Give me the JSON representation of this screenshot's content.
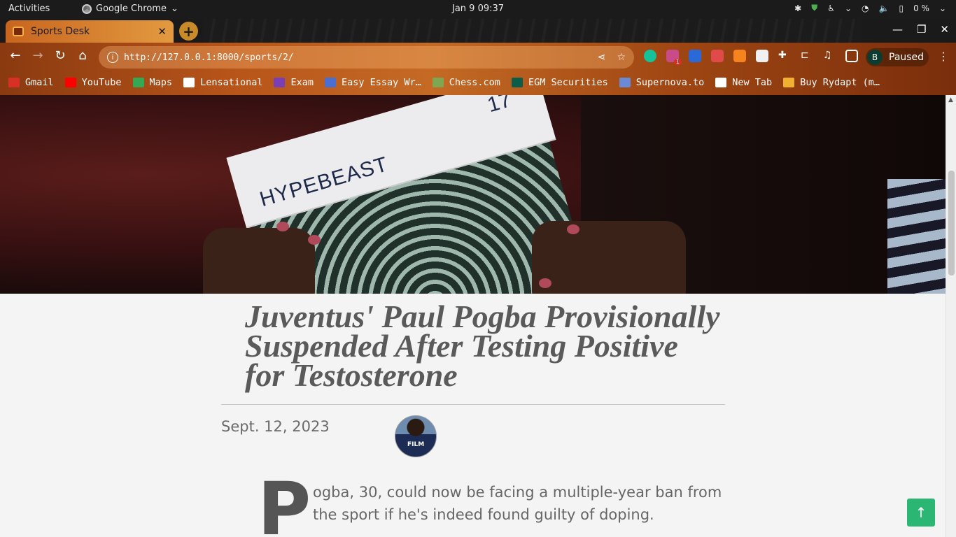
{
  "system_bar": {
    "activities": "Activities",
    "app_name": "Google Chrome",
    "clock": "Jan 9  09:37",
    "battery": "0 %"
  },
  "browser": {
    "tab_title": "Sports Desk",
    "url": "http://127.0.0.1:8000/sports/2/",
    "profile_initial": "B",
    "profile_status": "Paused",
    "extension_badge": "1"
  },
  "bookmarks": [
    {
      "label": "Gmail",
      "color": "#d93025"
    },
    {
      "label": "YouTube",
      "color": "#ff0000"
    },
    {
      "label": "Maps",
      "color": "#34a853"
    },
    {
      "label": "Lensational",
      "color": "#ffffff"
    },
    {
      "label": "Exam",
      "color": "#7b3fb5"
    },
    {
      "label": "Easy Essay Wr…",
      "color": "#4a6fd0"
    },
    {
      "label": "Chess.com",
      "color": "#7fa650"
    },
    {
      "label": "EGM Securities",
      "color": "#0c5c4a"
    },
    {
      "label": "Supernova.to",
      "color": "#6a8ad8"
    },
    {
      "label": "New Tab",
      "color": "#ffffff"
    },
    {
      "label": "Buy Rydapt (m…",
      "color": "#f0b030"
    }
  ],
  "article": {
    "hero_magazine_brand": "HYPEBEAST",
    "hero_magazine_issue": "17",
    "title": "Juventus' Paul Pogba Provisionally Suspended After Testing Positive for Testosterone",
    "date": "Sept. 12, 2023",
    "dropcap": "P",
    "body_first": "ogba, 30, could now be facing a multiple-year ban from the sport if he's indeed found guilty of doping.",
    "author_shirt_text": "FILM"
  },
  "colors": {
    "accent_green": "#2bb673",
    "headline": "#5a5a5a"
  }
}
